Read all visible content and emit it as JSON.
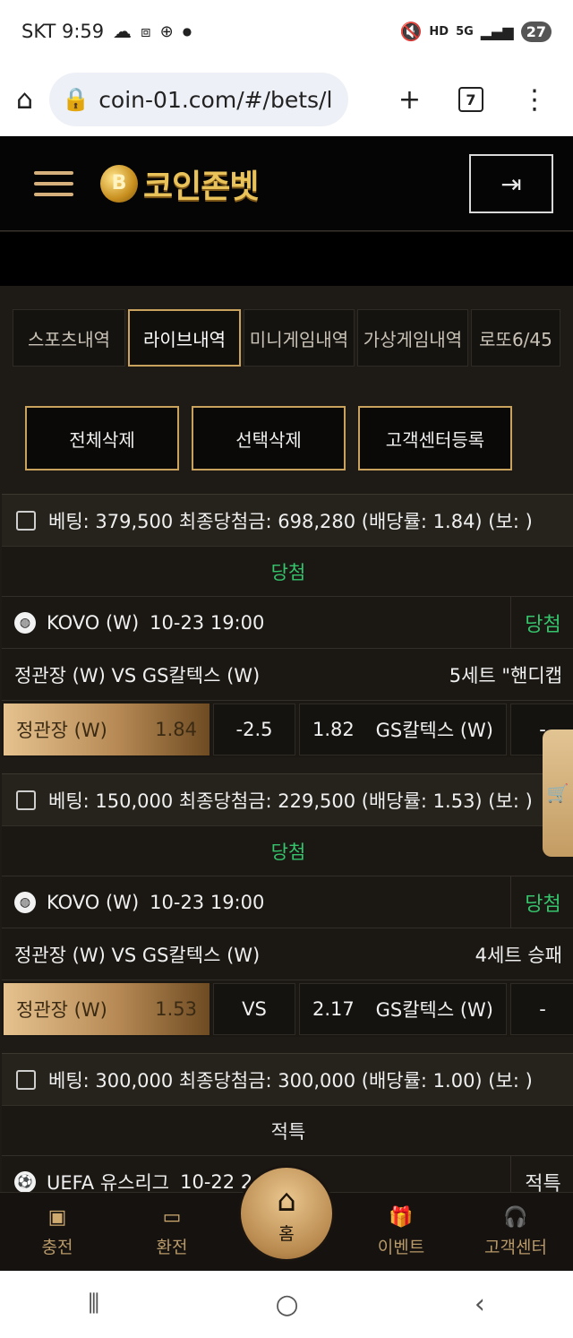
{
  "status_bar": {
    "carrier_time": "SKT 9:59",
    "icons": [
      "cloud-icon",
      "screenshot-icon",
      "mercedes-icon",
      "dot-icon"
    ],
    "right_icons": [
      "mute-icon",
      "hd-voice-icon",
      "5g-icon",
      "signal-icon"
    ],
    "hd_label": "HD",
    "net_label": "5G",
    "battery": "27"
  },
  "browser": {
    "url": "coin-01.com/#/bets/l",
    "tab_count": "7",
    "plus": "+",
    "menu": "⋮"
  },
  "header": {
    "logo_text": "코인존벳",
    "coin_symbol": "B"
  },
  "tabs": [
    {
      "label": "스포츠내역",
      "active": false
    },
    {
      "label": "라이브내역",
      "active": true
    },
    {
      "label": "미니게임내역",
      "active": false
    },
    {
      "label": "가상게임내역",
      "active": false
    },
    {
      "label": "로또6/45",
      "active": false
    }
  ],
  "actions": {
    "delete_all": "전체삭제",
    "delete_selected": "선택삭제",
    "register_support": "고객센터등록"
  },
  "bets": [
    {
      "summary": "베팅: 379,500 최종당첨금: 698,280 (배당률: 1.84) (보: )",
      "status": "당첨",
      "league": "KOVO (W)",
      "datetime": "10-23 19:00",
      "result": "당첨",
      "match": "정관장 (W) VS GS칼텍스 (W)",
      "market": "5세트 \"핸디캡",
      "home_team": "정관장 (W)",
      "home_odds": "1.84",
      "mid": "-2.5",
      "away_odds": "1.82",
      "away_team": "GS칼텍스 (W)",
      "dash": "-"
    },
    {
      "summary": "베팅: 150,000 최종당첨금: 229,500 (배당률: 1.53) (보: )",
      "status": "당첨",
      "league": "KOVO (W)",
      "datetime": "10-23 19:00",
      "result": "당첨",
      "match": "정관장 (W) VS GS칼텍스 (W)",
      "market": "4세트 승패",
      "home_team": "정관장 (W)",
      "home_odds": "1.53",
      "mid": "VS",
      "away_odds": "2.17",
      "away_team": "GS칼텍스 (W)",
      "dash": "-"
    },
    {
      "summary": "베팅: 300,000 최종당첨금: 300,000 (배당률: 1.00) (보: )",
      "status": "적특",
      "league": "UEFA 유스리그",
      "datetime": "10-22 2",
      "result": "적특"
    }
  ],
  "cart_icon": "cart-icon",
  "bottom_nav": {
    "charge": "충전",
    "exchange": "환전",
    "home": "홈",
    "event": "이벤트",
    "support": "고객센터"
  },
  "colors": {
    "gold": "#c9a35e",
    "win_green": "#35c36b",
    "background": "#1e1a15"
  }
}
